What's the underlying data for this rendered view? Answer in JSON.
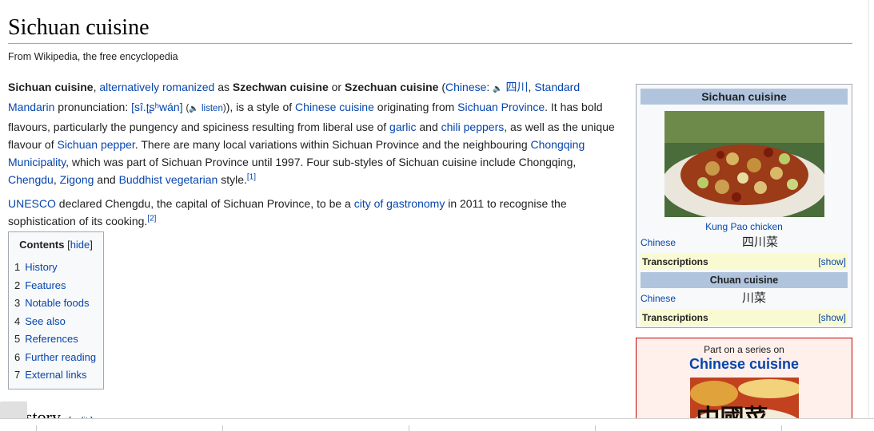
{
  "page": {
    "title": "Sichuan cuisine",
    "tagline": "From Wikipedia, the free encyclopedia"
  },
  "intro": {
    "p1": {
      "bold_name": "Sichuan cuisine",
      "comma1": ", ",
      "link_alt": "alternatively romanized",
      "as": " as ",
      "bold_szechwan": "Szechwan cuisine",
      "or": " or ",
      "bold_szechuan": "Szechuan cuisine",
      "paren_open": " (",
      "link_chinese": "Chinese",
      "colon": ": ",
      "speaker": "🔈",
      "link_hanzi": "四川",
      "comma2": ", ",
      "link_standard": "Standard Mandarin",
      "pron_label": " pronunciation: ",
      "link_ipa": "[sî.ʈʂʰwán]",
      "space": " ",
      "listen_open": "(",
      "speaker2": "🔈",
      "link_listen": " listen",
      "listen_close": ")",
      "text1": "), is a style of ",
      "link_chinese_cuisine": "Chinese cuisine",
      "text2": " originating from ",
      "link_sichuan_province": "Sichuan Province",
      "text3": ". It has bold flavours, particularly the pungency and spiciness resulting from liberal use of ",
      "link_garlic": "garlic",
      "text4": " and ",
      "link_chili": "chili peppers",
      "text5": ", as well as the unique flavour of ",
      "link_pepper": "Sichuan pepper",
      "text6": ". There are many local variations within Sichuan Province and the neighbouring ",
      "link_chongqing": "Chongqing Municipality",
      "text7": ", which was part of Sichuan Province until 1997. Four sub-styles of Sichuan cuisine include Chongqing, ",
      "link_chengdu": "Chengdu",
      "comma3": ", ",
      "link_zigong": "Zigong",
      "text8": " and ",
      "link_buddhist": "Buddhist vegetarian",
      "text9": " style.",
      "ref1": "[1]"
    },
    "p2": {
      "link_unesco": "UNESCO",
      "text1": " declared Chengdu, the capital of Sichuan Province, to be a ",
      "link_city": "city of gastronomy",
      "text2": " in 2011 to recognise the sophistication of its cooking.",
      "ref2": "[2]"
    }
  },
  "toc": {
    "title": "Contents",
    "hide_open": " [",
    "hide": "hide",
    "hide_close": "]",
    "items": [
      {
        "num": "1",
        "label": "History"
      },
      {
        "num": "2",
        "label": "Features"
      },
      {
        "num": "3",
        "label": "Notable foods"
      },
      {
        "num": "4",
        "label": "See also"
      },
      {
        "num": "5",
        "label": "References"
      },
      {
        "num": "6",
        "label": "Further reading"
      },
      {
        "num": "7",
        "label": "External links"
      }
    ]
  },
  "history_heading": {
    "label": "story",
    "edit": "[ edit ]"
  },
  "infobox": {
    "title": "Sichuan cuisine",
    "image_caption": "Kung Pao chicken",
    "row1_label": "Chinese",
    "row1_value": "四川菜",
    "trans_label": "Transcriptions",
    "trans_show": "[show]",
    "subheader": "Chuan cuisine",
    "row2_label": "Chinese",
    "row2_value": "川菜",
    "trans2_label": "Transcriptions",
    "trans2_show": "[show]"
  },
  "series": {
    "pre": "Part on a series on",
    "title": "Chinese cuisine",
    "image_text": "中國菜"
  },
  "colors": {
    "link": "#0645ad",
    "infobox_header": "#b0c4de",
    "transcriptions_bg": "#fafad2",
    "series_border": "#c00000",
    "series_bg": "#fff0ec"
  }
}
